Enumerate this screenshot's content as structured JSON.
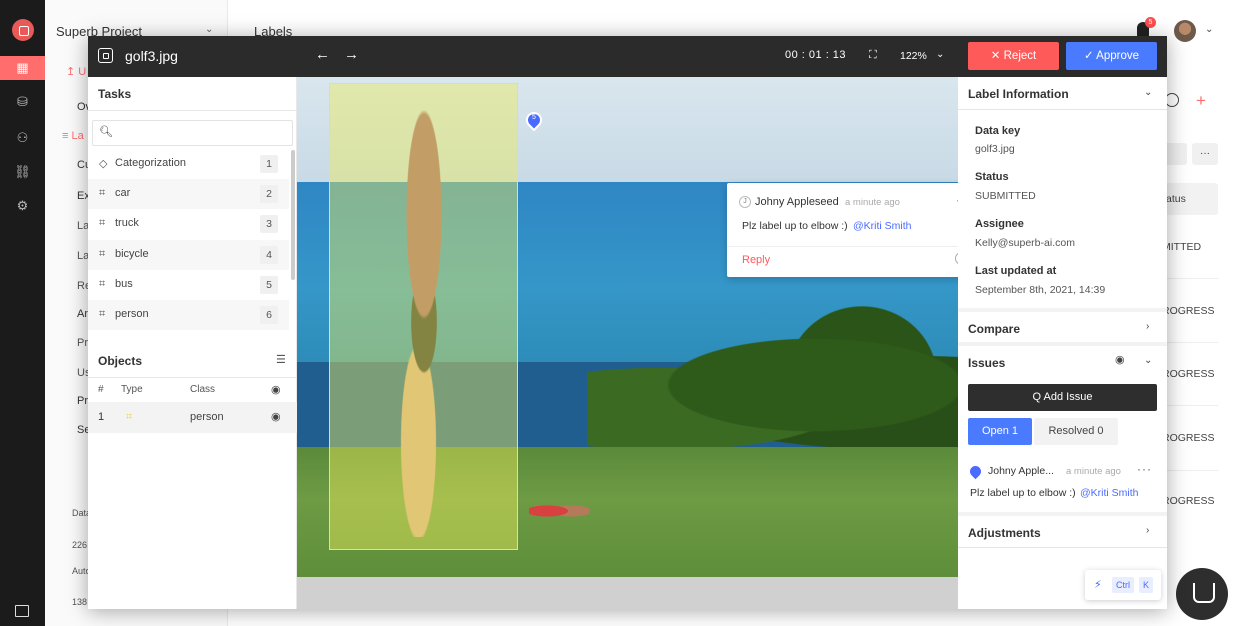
{
  "background": {
    "project_name": "Superb Project",
    "page_title": "Labels",
    "notification_count": "5",
    "menu_fragments": [
      "↥ U",
      "Ov",
      "≡ La",
      "Cu",
      "Ex",
      "La",
      "La",
      "Re",
      "An",
      "Pr",
      "Us",
      "Pr",
      "Se"
    ],
    "footer_fragments": [
      "Data",
      "226",
      "Auto",
      "138"
    ],
    "right_fragments": [
      "atus",
      "MITTED",
      "ROGRESS",
      "ROGRESS",
      "ROGRESS",
      "ROGRESS"
    ],
    "more": "···"
  },
  "topbar": {
    "file_name": "golf3.jpg",
    "back_arrow": "←",
    "forward_arrow": "→",
    "timer": "00 : 01 : 13",
    "zoom": "122%",
    "reject_label": "✕  Reject",
    "approve_label": "✓ Approve"
  },
  "tasks": {
    "title": "Tasks",
    "search_placeholder": "",
    "items": [
      {
        "label": "Categorization",
        "num": "1",
        "icon": "tag-icon"
      },
      {
        "label": "car",
        "num": "2",
        "icon": "box-icon"
      },
      {
        "label": "truck",
        "num": "3",
        "icon": "box-icon"
      },
      {
        "label": "bicycle",
        "num": "4",
        "icon": "box-icon"
      },
      {
        "label": "bus",
        "num": "5",
        "icon": "box-icon"
      },
      {
        "label": "person",
        "num": "6",
        "icon": "box-icon"
      }
    ]
  },
  "objects": {
    "title": "Objects",
    "col_num": "#",
    "col_type": "Type",
    "col_class": "Class",
    "row": {
      "num": "1",
      "class": "person"
    }
  },
  "comment": {
    "avatar_letter": "J",
    "author": "Johny Appleseed",
    "time": "a minute ago",
    "text": "Plz label up to elbow :)",
    "mention": "@Kriti Smith",
    "reply_label": "Reply",
    "marker_num": "5"
  },
  "label_info": {
    "title": "Label Information",
    "data_key_label": "Data key",
    "data_key": "golf3.jpg",
    "status_label": "Status",
    "status": "SUBMITTED",
    "assignee_label": "Assignee",
    "assignee": "Kelly@superb-ai.com",
    "updated_label": "Last updated at",
    "updated": "September 8th, 2021, 14:39"
  },
  "compare": {
    "title": "Compare"
  },
  "issues": {
    "title": "Issues",
    "add_label": "Q  Add Issue",
    "open_tab": "Open 1",
    "resolved_tab": "Resolved 0",
    "author": "Johny Apple...",
    "time": "a minute ago",
    "text": "Plz label up to elbow :)",
    "mention": "@Kriti Smith"
  },
  "adjustments": {
    "title": "Adjustments"
  },
  "shortcut": {
    "ctrl": "Ctrl",
    "k": "K"
  },
  "colors": {
    "reject": "#ff5a5a",
    "approve": "#4a7bff",
    "bbox": "#e8e85a",
    "accent": "#ff6d6d"
  }
}
